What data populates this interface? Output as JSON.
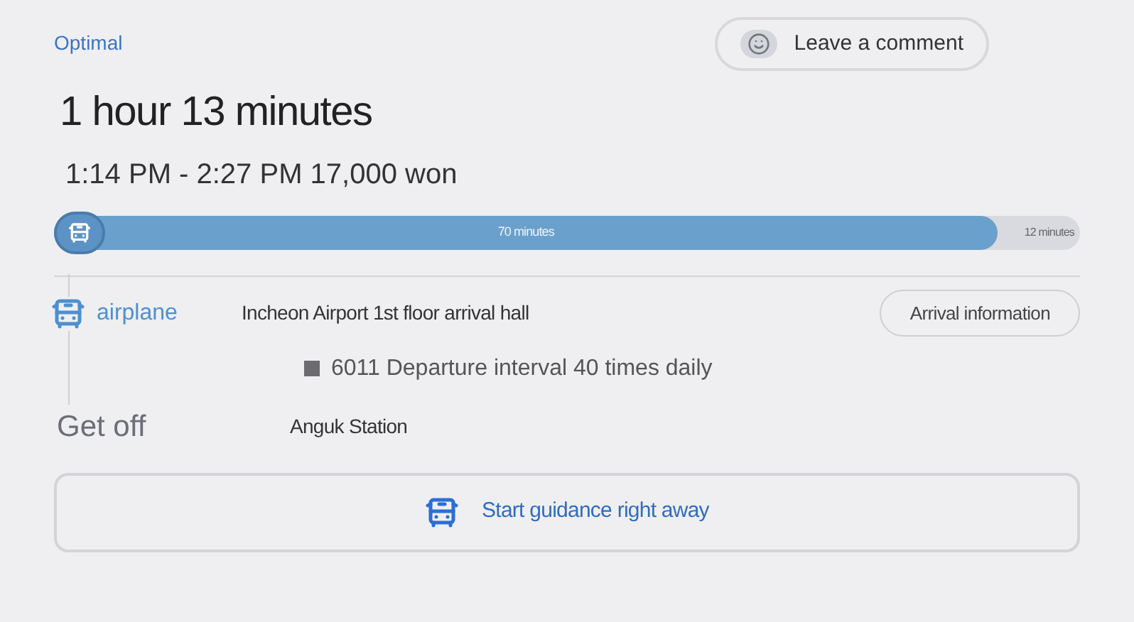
{
  "route_label": "Optimal",
  "comment_button": "Leave a comment",
  "duration": "1 hour 13 minutes",
  "summary": "1:14 PM - 2:27 PM 17,000 won",
  "progress": {
    "level": 0.92,
    "ride_label": "70 minutes",
    "rest_label": "12 minutes"
  },
  "steps": [
    {
      "kind": "board",
      "mode": "airplane",
      "stop": "Incheon Airport 1st floor arrival hall",
      "detail": "6011 Departure interval 40 times daily",
      "button": "Arrival information"
    },
    {
      "kind": "alight",
      "mode": "Get off",
      "stop": "Anguk Station"
    }
  ],
  "start_button": "Start guidance right away"
}
